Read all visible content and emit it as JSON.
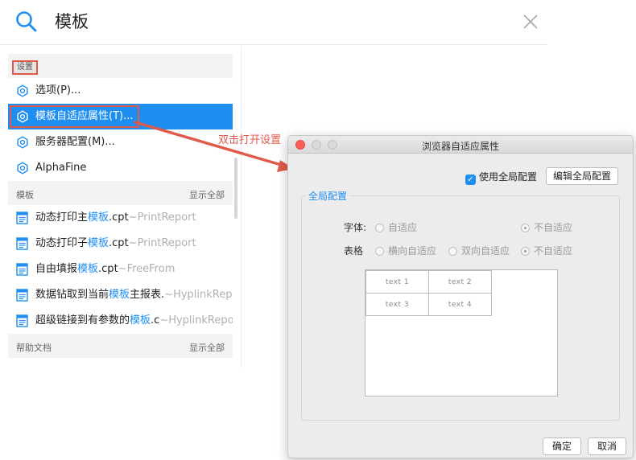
{
  "search": {
    "query": "模板",
    "icon": "search-icon",
    "close_icon": "close-icon"
  },
  "sections": {
    "settings": {
      "tag": "设置",
      "items": [
        {
          "label": "选项(P)...",
          "icon": "gear-icon"
        },
        {
          "label": "模板自适应属性(T)...",
          "icon": "gear-icon",
          "selected": true
        },
        {
          "label": "服务器配置(M)...",
          "icon": "gear-icon"
        },
        {
          "label": "AlphaFine",
          "icon": "gear-icon"
        }
      ]
    },
    "templates": {
      "title": "模板",
      "show_all": "显示全部",
      "items": [
        {
          "pre": "动态打印主",
          "hl": "模板",
          "post": ".cpt",
          "src": "~PrintReport"
        },
        {
          "pre": "动态打印子",
          "hl": "模板",
          "post": ".cpt",
          "src": "~PrintReport"
        },
        {
          "pre": "自由填报",
          "hl": "模板",
          "post": ".cpt",
          "src": "~FreeFrom"
        },
        {
          "pre": "数据钻取到当前",
          "hl": "模板",
          "post": "主报表.",
          "src": "~HyplinkReport"
        },
        {
          "pre": "超级链接到有参数的",
          "hl": "模板",
          "post": ".c",
          "src": "~HyplinkReport"
        }
      ]
    },
    "help": {
      "title": "帮助文档",
      "show_all": "显示全部"
    }
  },
  "annotation": {
    "text": "双击打开设置",
    "color": "#e05a4b"
  },
  "dialog": {
    "title": "浏览器自适应属性",
    "use_global_label": "使用全局配置",
    "use_global_checked": true,
    "edit_global_label": "编辑全局配置",
    "group_title": "全局配置",
    "font_row": {
      "label": "字体:",
      "options": [
        "自适应",
        "不自适应"
      ],
      "selected": "不自适应"
    },
    "table_row": {
      "label": "表格",
      "options": [
        "横向自适应",
        "双向自适应",
        "不自适应"
      ],
      "selected": "不自适应"
    },
    "preview_cells": [
      "text 1",
      "text 2",
      "text 3",
      "text 4"
    ],
    "ok_label": "确定",
    "cancel_label": "取消"
  },
  "colors": {
    "accent": "#1e8ef0",
    "highlight_border": "#e05a4b"
  }
}
